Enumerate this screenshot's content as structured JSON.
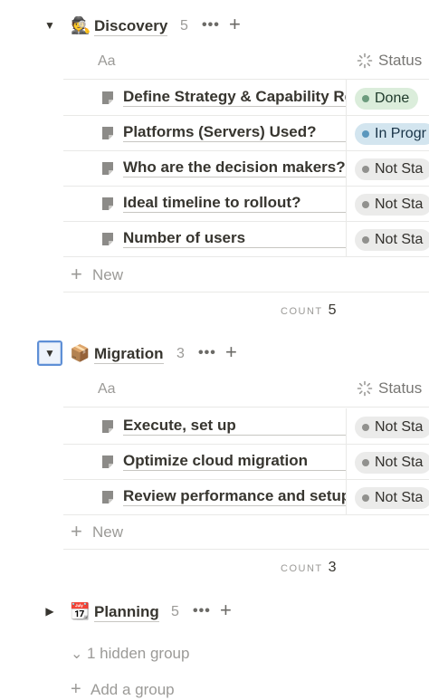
{
  "groups": [
    {
      "emoji": "🕵️",
      "title": "Discovery",
      "count": "5",
      "col_title_label": "Aa",
      "col_status_label": "Status",
      "rows": [
        {
          "title": "Define Strategy & Capability Re",
          "status": "Done"
        },
        {
          "title": "Platforms (Servers) Used?",
          "status": "In Progr"
        },
        {
          "title": "Who are the decision makers?",
          "status": "Not Sta"
        },
        {
          "title": "Ideal timeline to rollout?",
          "status": "Not Sta"
        },
        {
          "title": "Number of users",
          "status": "Not Sta"
        }
      ],
      "new_label": "New",
      "count_label": "COUNT",
      "count_value": "5"
    },
    {
      "emoji": "📦",
      "title": "Migration",
      "count": "3",
      "col_title_label": "Aa",
      "col_status_label": "Status",
      "rows": [
        {
          "title": "Execute, set up",
          "status": "Not Sta"
        },
        {
          "title": "Optimize cloud migration",
          "status": "Not Sta"
        },
        {
          "title": "Review performance and setup",
          "status": "Not Sta"
        }
      ],
      "new_label": "New",
      "count_label": "COUNT",
      "count_value": "3"
    },
    {
      "emoji": "📆",
      "title": "Planning",
      "count": "5"
    }
  ],
  "footer": {
    "hidden_groups_label": "1 hidden group",
    "add_group_label": "Add a group"
  },
  "icons": {
    "toggle_open": "▼",
    "toggle_closed": "▶",
    "more": "•••",
    "add": "+",
    "chevron_down": "⌄"
  },
  "colors": {
    "done_bg": "#dbeddb",
    "in_progress_bg": "#d3e5ef",
    "not_started_bg": "#ebebea",
    "focus_ring": "#5e8fd6"
  }
}
